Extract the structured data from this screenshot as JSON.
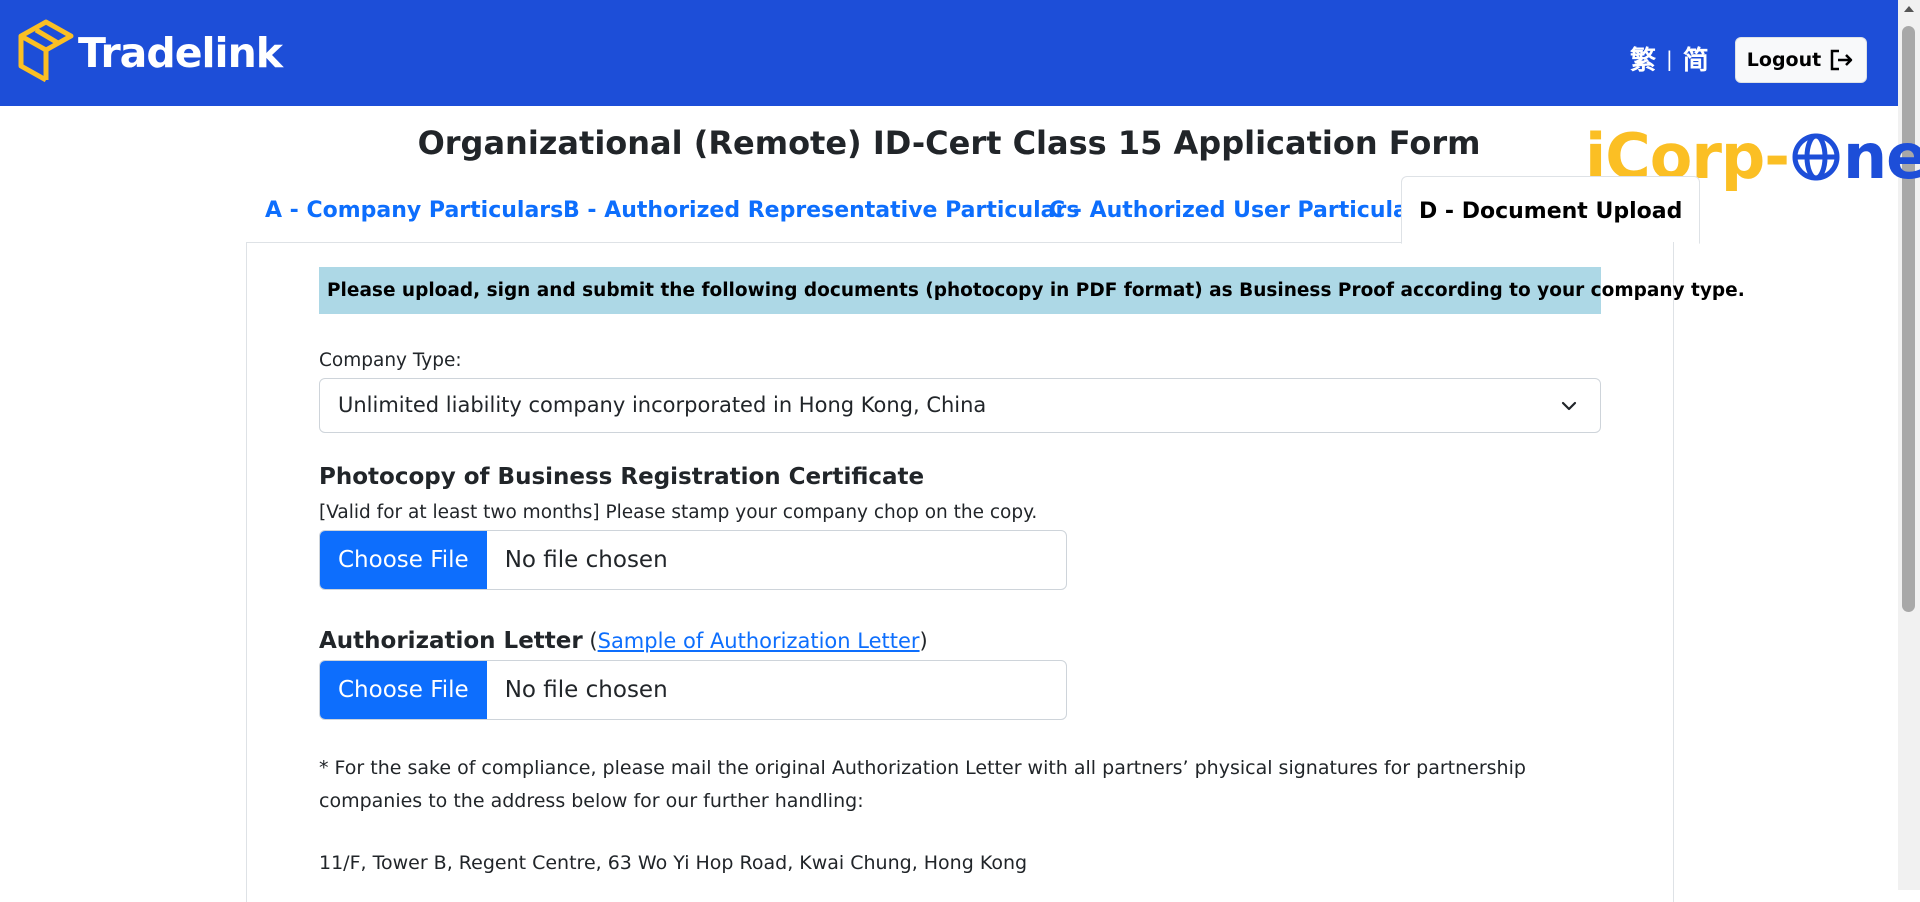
{
  "header": {
    "brand": "Tradelink",
    "lang_traditional": "繁",
    "lang_separator": "|",
    "lang_simplified": "简",
    "logout_label": "Logout"
  },
  "page_title": "Organizational (Remote) ID-Cert Class 15 Application Form",
  "brand_mark": {
    "part1": "iCorp-",
    "part2": "ne"
  },
  "tabs": [
    {
      "label": "A - Company Particulars",
      "active": false
    },
    {
      "label": "B - Authorized Representative Particulars",
      "active": false
    },
    {
      "label": "C - Authorized User Particulars",
      "active": false
    },
    {
      "label": "D - Document Upload",
      "active": true
    }
  ],
  "form": {
    "alert": "Please upload, sign and submit the following documents (photocopy in PDF format) as Business Proof according to your company type.",
    "company_type_label": "Company Type:",
    "company_type_value": "Unlimited liability company incorporated in Hong Kong, China",
    "br_title": "Photocopy of Business Registration Certificate",
    "br_hint": "[Valid for at least two months] Please stamp your company chop on the copy.",
    "auth_title": "Authorization Letter",
    "auth_open": " (",
    "auth_link": "Sample of Authorization Letter",
    "auth_close": ")",
    "file_button": "Choose File",
    "file_status": "No file chosen",
    "note": "* For the sake of compliance, please mail the original Authorization Letter with all partners’ physical signatures for partnership companies to the address below for our further handling:",
    "address": "11/F, Tower B, Regent Centre, 63 Wo Yi Hop Road, Kwai Chung, Hong Kong"
  },
  "colors": {
    "header": "#1d4ed8",
    "accent": "#0d6efd",
    "alert_bg": "#add8e6",
    "logo_yellow": "#fbbf24"
  }
}
